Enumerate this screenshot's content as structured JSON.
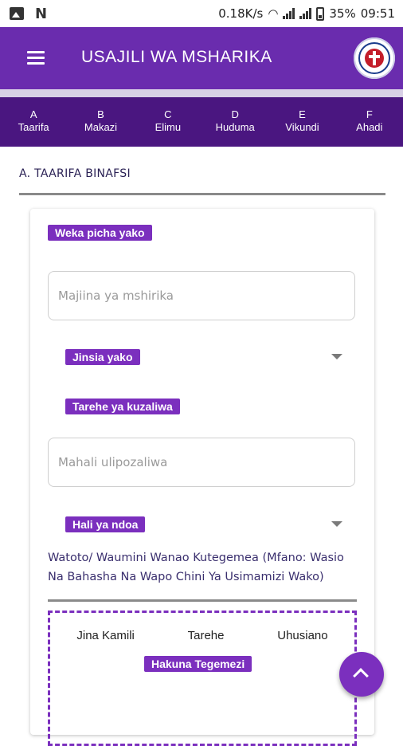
{
  "status_bar": {
    "speed": "0.18K/s",
    "battery": "35%",
    "time": "09:51",
    "left_icons": [
      "image-icon",
      "n-icon"
    ],
    "right_icons": [
      "wifi-icon",
      "signal-icon",
      "signal-icon",
      "battery-icon"
    ]
  },
  "app_bar": {
    "title": "USAJILI WA MSHARIKA",
    "menu_icon": "menu-icon",
    "logo": "church-logo",
    "color": "#6a2cae"
  },
  "steps": [
    {
      "letter": "A",
      "name": "Taarifa"
    },
    {
      "letter": "B",
      "name": "Makazi"
    },
    {
      "letter": "C",
      "name": "Elimu"
    },
    {
      "letter": "D",
      "name": "Huduma"
    },
    {
      "letter": "E",
      "name": "Vikundi"
    },
    {
      "letter": "F",
      "name": "Ahadi"
    }
  ],
  "section": {
    "title": "A. TAARIFA BINAFSI"
  },
  "form": {
    "photo_label": "Weka picha yako",
    "name_placeholder": "Majiina ya mshirika",
    "gender_label": "Jinsia yako",
    "dob_label": "Tarehe ya kuzaliwa",
    "birthplace_placeholder": "Mahali ulipozaliwa",
    "marital_label": "Hali ya ndoa",
    "dependents_note": "Watoto/ Waumini Wanao Kutegemea (Mfano: Wasio Na Bahasha Na Wapo Chini Ya Usimamizi Wako)",
    "dependents": {
      "headers": [
        "Jina Kamili",
        "Tarehe",
        "Uhusiano"
      ],
      "empty_label": "Hakuna Tegemezi"
    }
  },
  "colors": {
    "primary": "#6a2cae",
    "dark": "#4a1680",
    "chip": "#7b2fbe"
  }
}
